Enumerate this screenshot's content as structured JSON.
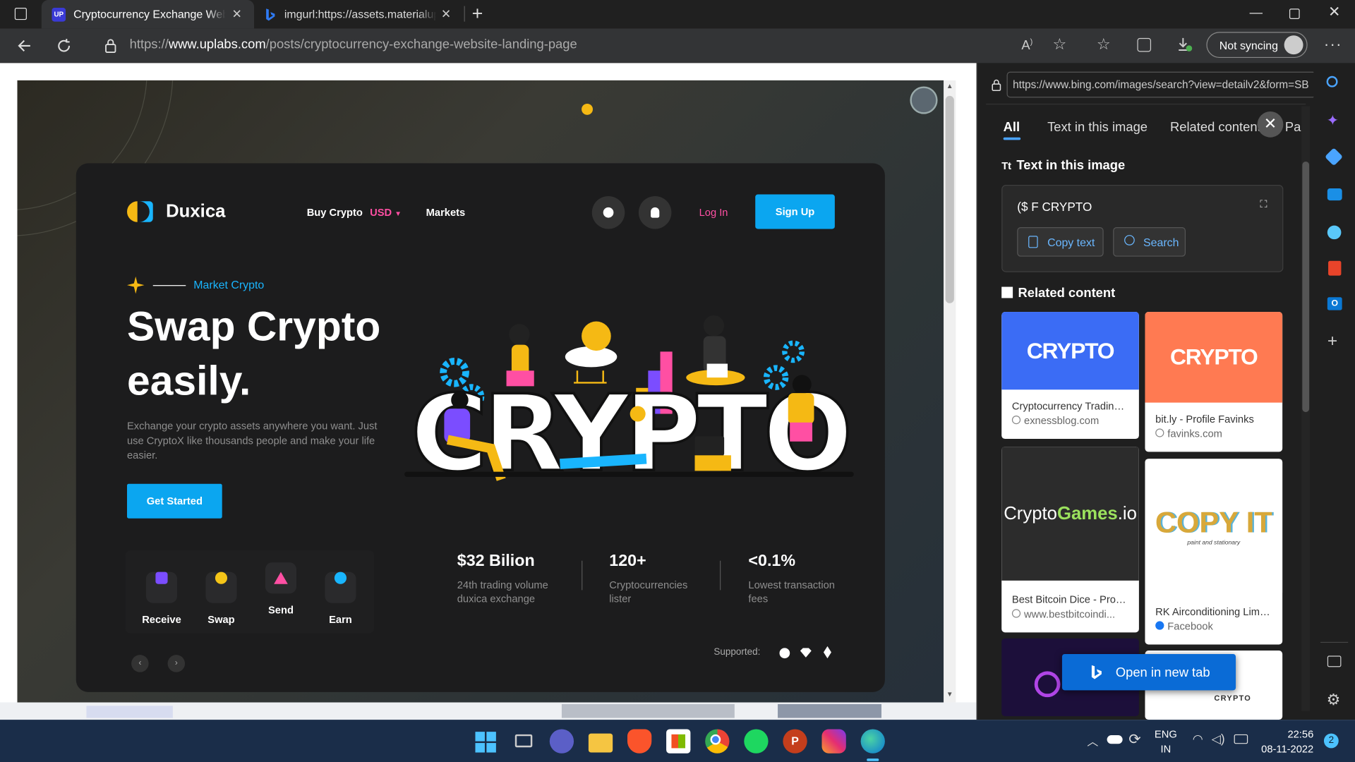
{
  "browser": {
    "tabs": [
      {
        "label": "Cryptocurrency Exchange Websit",
        "favicon": "uplabs-icon",
        "active": true
      },
      {
        "label": "imgurl:https://assets.materialup.",
        "favicon": "bing-icon",
        "active": false
      }
    ],
    "url": {
      "prefix": "https://",
      "domain": "www.uplabs.com",
      "path": "/posts/cryptocurrency-exchange-website-landing-page"
    },
    "sync_label": "Not syncing"
  },
  "landing": {
    "brand": "Duxica",
    "nav": {
      "buy": "Buy Crypto",
      "currency": "USD",
      "markets": "Markets",
      "login": "Log In",
      "signup": "Sign Up"
    },
    "eyebrow": "Market Crypto",
    "hero": "Swap Crypto easily.",
    "description": "Exchange your crypto assets anywhere you want. Just use CryptoX like thousands people and make your life easier.",
    "cta": "Get Started",
    "actions": [
      {
        "label": "Receive",
        "color": "#7b4dff"
      },
      {
        "label": "Swap",
        "color": "#f5c518"
      },
      {
        "label": "Send",
        "color": "#ff4fa3"
      },
      {
        "label": "Earn",
        "color": "#19b5fe"
      }
    ],
    "stats": [
      {
        "value": "$32 Bilion",
        "label": "24th trading volume duxica exchange"
      },
      {
        "value": "120+",
        "label": "Cryptocurrencies lister"
      },
      {
        "value": "<0.1%",
        "label": "Lowest transaction fees"
      }
    ],
    "supported_label": "Supported:",
    "art_word": "CRYPTO"
  },
  "visual_search": {
    "url": "https://www.bing.com/images/search?view=detailv2&form=SB",
    "tabs": [
      "All",
      "Text in this image",
      "Related content",
      "Pa"
    ],
    "text_section_title": "Text in this image",
    "extracted_text": "($ F CRYPTO",
    "copy_label": "Copy text",
    "search_label": "Search",
    "related_title": "Related content",
    "results": [
      {
        "title": "Cryptocurrency Trading:...",
        "source": "exnessblog.com"
      },
      {
        "title": "bit.ly - Profile Favinks",
        "source": "favinks.com"
      },
      {
        "title": "Best Bitcoin Dice - Prov...",
        "source": "www.bestbitcoindi..."
      },
      {
        "title": "RK Airconditioning Limit...",
        "source": "Facebook"
      }
    ],
    "thumb_text": {
      "games_a": "Crypto",
      "games_b": "Games",
      "games_c": ".io",
      "copyit": "COPY IT",
      "copyit_sub": "paint and stationary",
      "crypto_small": "CRYPTO"
    },
    "open_label": "Open in new tab"
  },
  "taskbar": {
    "lang": "ENG",
    "region": "IN",
    "time": "22:56",
    "date": "08-11-2022",
    "badge": "2"
  },
  "colors": {
    "accent": "#0ba6f0",
    "login": "#ff4fa3",
    "edge_blue": "#0a6bd6"
  }
}
